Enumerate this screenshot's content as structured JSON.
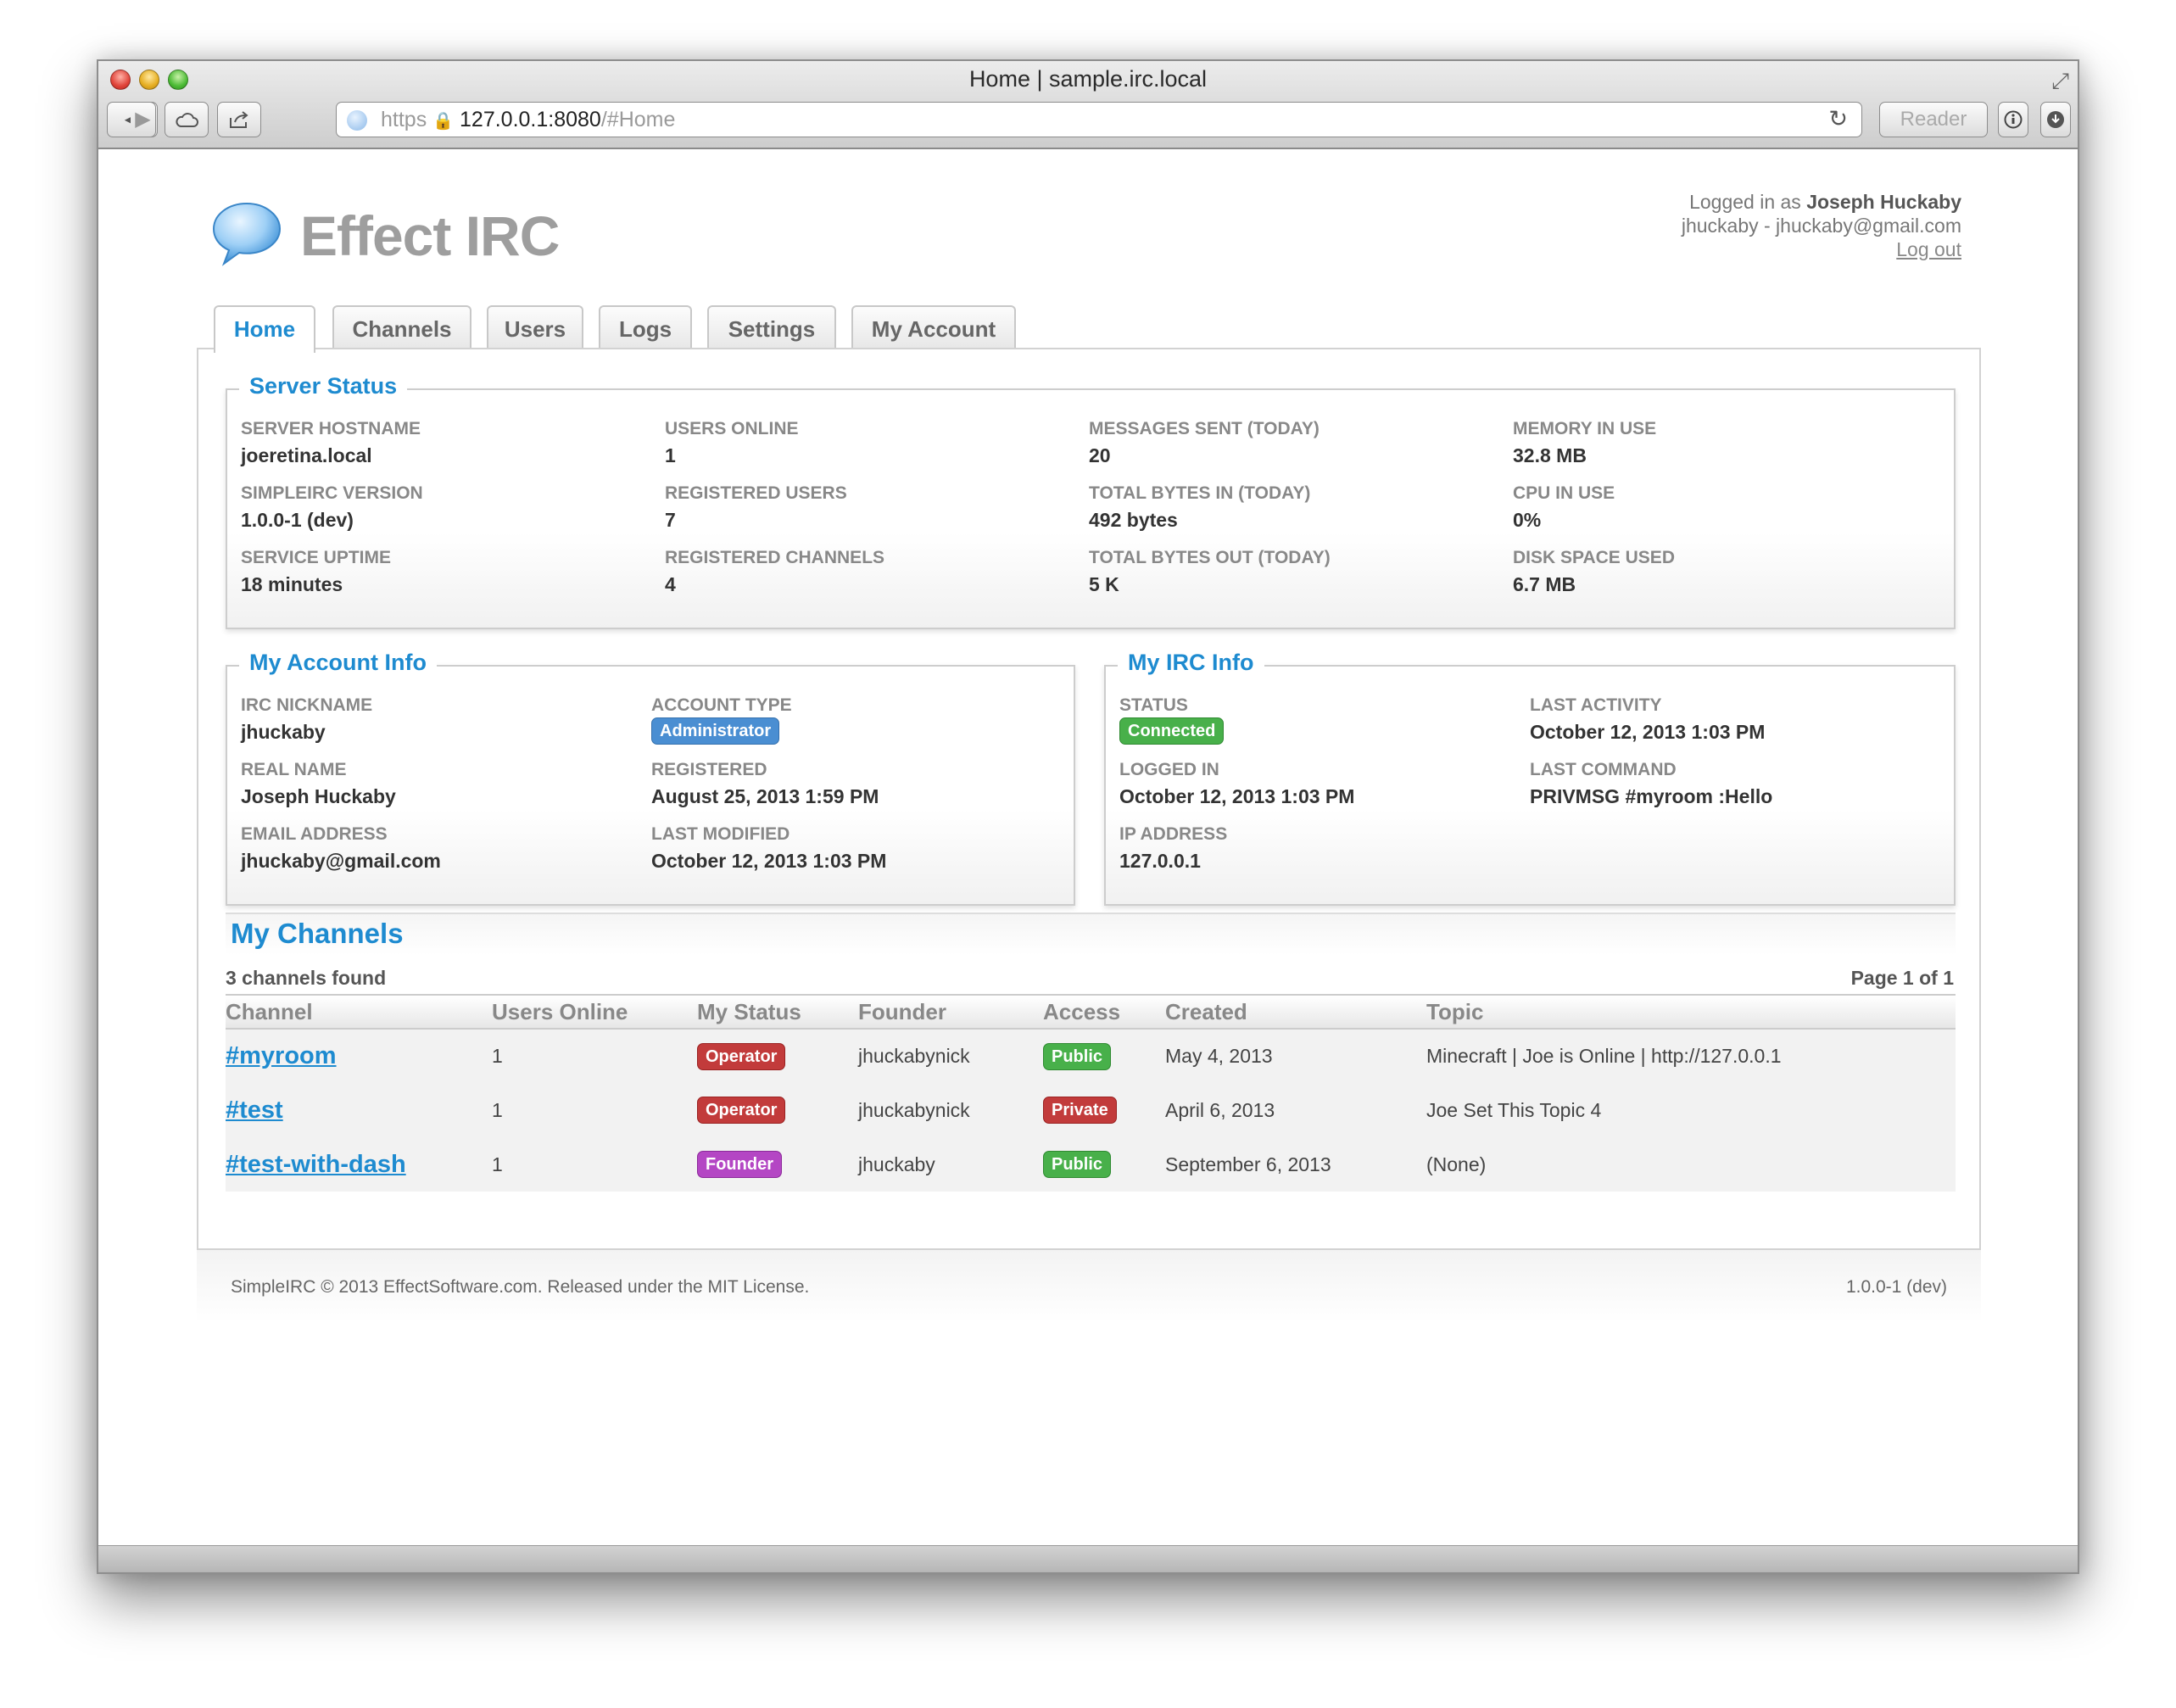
{
  "browser": {
    "window_title": "Home | sample.irc.local",
    "url_scheme": "https",
    "url_host": "127.0.0.1:8080",
    "url_path": "/#Home",
    "reader_label": "Reader"
  },
  "header": {
    "brand": "Effect IRC",
    "logged_in_prefix": "Logged in as",
    "user_name": "Joseph Huckaby",
    "user_line": "jhuckaby - jhuckaby@gmail.com",
    "logout": "Log out"
  },
  "tabs": [
    {
      "label": "Home",
      "active": true
    },
    {
      "label": "Channels"
    },
    {
      "label": "Users"
    },
    {
      "label": "Logs"
    },
    {
      "label": "Settings"
    },
    {
      "label": "My Account"
    }
  ],
  "server_status": {
    "title": "Server Status",
    "fields": [
      {
        "label": "SERVER HOSTNAME",
        "value": "joeretina.local"
      },
      {
        "label": "USERS ONLINE",
        "value": "1"
      },
      {
        "label": "MESSAGES SENT (TODAY)",
        "value": "20"
      },
      {
        "label": "MEMORY IN USE",
        "value": "32.8 MB"
      },
      {
        "label": "SIMPLEIRC VERSION",
        "value": "1.0.0-1 (dev)"
      },
      {
        "label": "REGISTERED USERS",
        "value": "7"
      },
      {
        "label": "TOTAL BYTES IN (TODAY)",
        "value": "492 bytes"
      },
      {
        "label": "CPU IN USE",
        "value": "0%"
      },
      {
        "label": "SERVICE UPTIME",
        "value": "18 minutes"
      },
      {
        "label": "REGISTERED CHANNELS",
        "value": "4"
      },
      {
        "label": "TOTAL BYTES OUT (TODAY)",
        "value": "5 K"
      },
      {
        "label": "DISK SPACE USED",
        "value": "6.7 MB"
      }
    ]
  },
  "account_info": {
    "title": "My Account Info",
    "fields": [
      {
        "label": "IRC NICKNAME",
        "value": "jhuckaby"
      },
      {
        "label": "ACCOUNT TYPE",
        "value": "Administrator"
      },
      {
        "label": "REAL NAME",
        "value": "Joseph Huckaby"
      },
      {
        "label": "REGISTERED",
        "value": "August 25, 2013 1:59 PM"
      },
      {
        "label": "EMAIL ADDRESS",
        "value": "jhuckaby@gmail.com"
      },
      {
        "label": "LAST MODIFIED",
        "value": "October 12, 2013 1:03 PM"
      }
    ]
  },
  "irc_info": {
    "title": "My IRC Info",
    "fields": [
      {
        "label": "STATUS",
        "value": "Connected"
      },
      {
        "label": "LAST ACTIVITY",
        "value": "October 12, 2013 1:03 PM"
      },
      {
        "label": "LOGGED IN",
        "value": "October 12, 2013 1:03 PM"
      },
      {
        "label": "LAST COMMAND",
        "value": "PRIVMSG #myroom :Hello"
      },
      {
        "label": "IP ADDRESS",
        "value": "127.0.0.1"
      }
    ]
  },
  "channels": {
    "title": "My Channels",
    "found": "3 channels found",
    "page": "Page 1 of 1",
    "columns": [
      "Channel",
      "Users Online",
      "My Status",
      "Founder",
      "Access",
      "Created",
      "Topic"
    ],
    "rows": [
      {
        "channel": "#myroom",
        "users": "1",
        "status": "Operator",
        "founder": "jhuckabynick",
        "access": "Public",
        "created": "May 4, 2013",
        "topic": "Minecraft | Joe is Online | http://127.0.0.1"
      },
      {
        "channel": "#test",
        "users": "1",
        "status": "Operator",
        "founder": "jhuckabynick",
        "access": "Private",
        "created": "April 6, 2013",
        "topic": "Joe Set This Topic 4"
      },
      {
        "channel": "#test-with-dash",
        "users": "1",
        "status": "Founder",
        "founder": "jhuckaby",
        "access": "Public",
        "created": "September 6, 2013",
        "topic": "(None)"
      }
    ]
  },
  "footer": {
    "left": "SimpleIRC © 2013 EffectSoftware.com. Released under the MIT License.",
    "right": "1.0.0-1 (dev)"
  },
  "colors": {
    "accent": "#1e8bd0",
    "admin_badge": "#4a8ed2",
    "green_badge": "#48b04a",
    "red_badge": "#c23b3b",
    "purple_badge": "#b446c4"
  }
}
